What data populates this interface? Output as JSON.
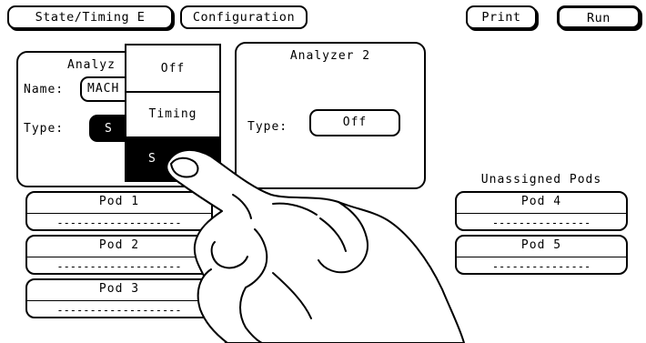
{
  "toolbar": {
    "mode_tab": "State/Timing E",
    "config_tab": "Configuration",
    "print_label": "Print",
    "run_label": "Run"
  },
  "analyzer1": {
    "title": "Analyz",
    "name_label": "Name:",
    "name_value": "MACH",
    "type_label": "Type:",
    "type_value": "S"
  },
  "analyzer2": {
    "title": "Analyzer 2",
    "type_label": "Type:",
    "type_value": "Off"
  },
  "type_menu": {
    "options": [
      "Off",
      "Timing",
      "S"
    ],
    "selected": "S"
  },
  "unassigned_title": "Unassigned Pods",
  "pods_left": [
    {
      "label": "Pod 1",
      "value": "-------------------"
    },
    {
      "label": "Pod 2",
      "value": "-------------------"
    },
    {
      "label": "Pod 3",
      "value": "-------------------"
    }
  ],
  "pods_right": [
    {
      "label": "Pod 4",
      "value": "---------------"
    },
    {
      "label": "Pod 5",
      "value": "---------------"
    }
  ]
}
